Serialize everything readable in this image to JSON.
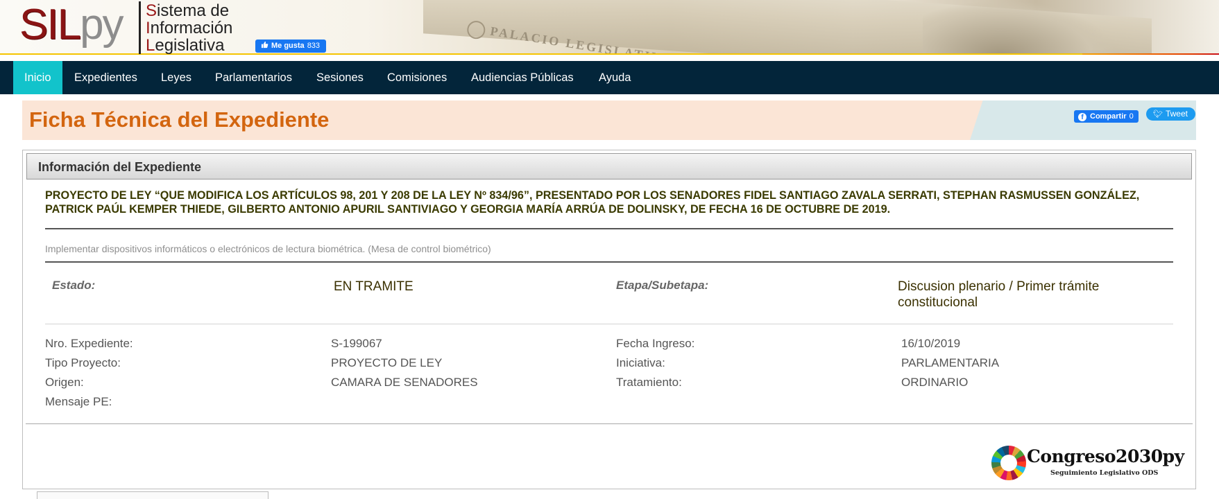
{
  "header": {
    "logo_sil": "SIL",
    "logo_py": "py",
    "system_name": {
      "line1_cap": "S",
      "line1_rest": "istema de",
      "line2_cap": "I",
      "line2_rest": "nformación",
      "line3_cap": "L",
      "line3_rest": "egislativa"
    },
    "building_sign": "PALACIO LEGISLATIVO",
    "fb_like": {
      "label": "Me gusta",
      "count": "833"
    }
  },
  "nav": {
    "items": [
      {
        "label": "Inicio",
        "active": true
      },
      {
        "label": "Expedientes"
      },
      {
        "label": "Leyes"
      },
      {
        "label": "Parlamentarios"
      },
      {
        "label": "Sesiones"
      },
      {
        "label": "Comisiones"
      },
      {
        "label": "Audiencias Públicas"
      },
      {
        "label": "Ayuda"
      }
    ]
  },
  "page": {
    "title": "Ficha Técnica del Expediente",
    "share": {
      "label": "Compartir",
      "count": "0"
    },
    "tweet": {
      "label": "Tweet"
    }
  },
  "panel": {
    "heading": "Información del Expediente",
    "project_title": "PROYECTO DE LEY “QUE MODIFICA LOS ARTÍCULOS 98, 201 Y 208 DE LA LEY Nº 834/96”, PRESENTADO POR LOS SENADORES FIDEL SANTIAGO ZAVALA SERRATI, STEPHAN RASMUSSEN GONZÁLEZ, PATRICK PAÚL KEMPER THIEDE, GILBERTO ANTONIO APURIL SANTIVIAGO Y GEORGIA MARÍA ARRÚA DE DOLINSKY, DE FECHA 16 DE OCTUBRE DE 2019.",
    "summary": "Implementar dispositivos informáticos o electrónicos de lectura biométrica. (Mesa de control biométrico)",
    "estado_label": "Estado:",
    "estado_value": "EN TRAMITE",
    "etapa_label": "Etapa/Subetapa:",
    "etapa_value": "Discusion plenario / Primer trámite constitucional",
    "details": {
      "nro_expediente": {
        "label": "Nro. Expediente:",
        "value": "S-199067"
      },
      "fecha_ingreso": {
        "label": "Fecha Ingreso:",
        "value": "16/10/2019"
      },
      "tipo_proyecto": {
        "label": "Tipo Proyecto:",
        "value": "PROYECTO DE LEY"
      },
      "iniciativa": {
        "label": "Iniciativa:",
        "value": "PARLAMENTARIA"
      },
      "origen": {
        "label": "Origen:",
        "value": "CAMARA DE SENADORES"
      },
      "tratamiento": {
        "label": "Tratamiento:",
        "value": "ORDINARIO"
      },
      "mensaje_pe": {
        "label": "Mensaje PE:",
        "value": ""
      }
    },
    "ods_logo": {
      "name": "Congreso2030py",
      "subtitle": "Seguimiento Legislativo ODS"
    }
  },
  "colors": {
    "nav_bg": "#03253a",
    "nav_active": "#12c3cb",
    "title_orange": "#d3650f",
    "logo_red": "#8a1414",
    "facebook_blue": "#1877f2",
    "twitter_blue": "#1d9bf0"
  },
  "icons": [
    "thumbs-up-icon",
    "facebook-icon",
    "twitter-bird-icon",
    "sdg-wheel-icon"
  ]
}
